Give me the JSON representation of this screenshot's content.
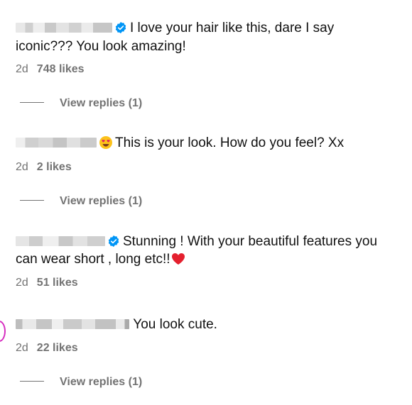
{
  "comments": [
    {
      "verified": true,
      "emoji": "",
      "text_line1": "I love your hair like this, dare I say",
      "text_line2": "iconic??? You look amazing!",
      "time": "2d",
      "likes": "748 likes",
      "replies": "View replies (1)"
    },
    {
      "verified": false,
      "emoji": "smiling-face-with-heart-eyes",
      "text_line1": "This is your look. How do you feel? Xx",
      "time": "2d",
      "likes": "2 likes",
      "replies": "View replies (1)"
    },
    {
      "verified": true,
      "emoji": "",
      "text_line1": "Stunning ! With your beautiful features you",
      "text_line2": "can wear short , long etc!!",
      "trailing_emoji": "red-heart",
      "time": "2d",
      "likes": "51 likes"
    },
    {
      "verified": false,
      "text_line1": "You look cute.",
      "time": "2d",
      "likes": "22 likes",
      "replies": "View replies (1)"
    }
  ],
  "colors": {
    "verified_blue": "#0095f6",
    "meta_gray": "#737373",
    "story_ring": "#d62fc0"
  }
}
